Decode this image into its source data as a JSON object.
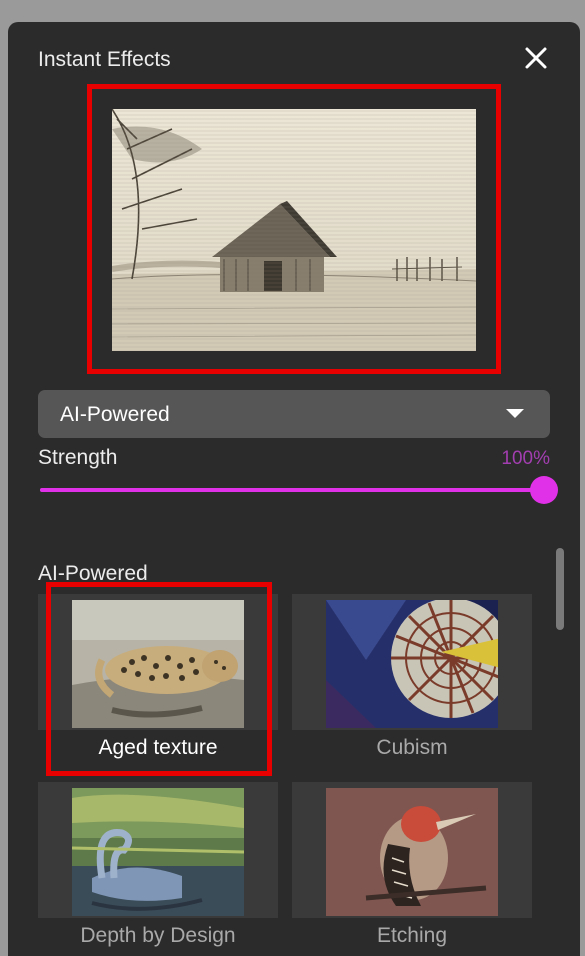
{
  "panel": {
    "title": "Instant Effects",
    "close_icon": "close-icon"
  },
  "preview": {
    "image": "aged-texture-barn-preview"
  },
  "dropdown": {
    "selected": "AI-Powered",
    "arrow_icon": "chevron-down-icon"
  },
  "strength": {
    "label": "Strength",
    "value_text": "100%",
    "value": 100
  },
  "section": {
    "label": "AI-Powered"
  },
  "effects": [
    {
      "label": "Aged texture",
      "selected": true
    },
    {
      "label": "Cubism",
      "selected": false
    },
    {
      "label": "Depth by Design",
      "selected": false
    },
    {
      "label": "Etching",
      "selected": false
    }
  ],
  "colors": {
    "accent": "#e030e8",
    "highlight": "#e80000",
    "panel_bg": "#2b2b2b"
  }
}
